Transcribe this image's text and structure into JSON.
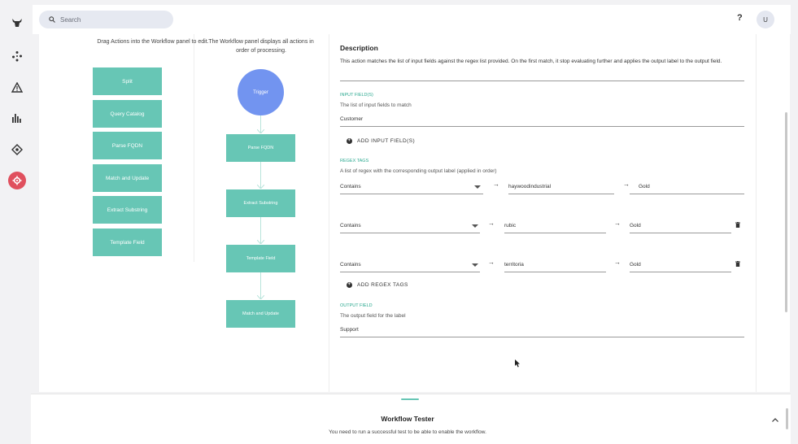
{
  "search": {
    "placeholder": "Search"
  },
  "header": {
    "help_label": "?",
    "avatar_initial": "U"
  },
  "nav": {
    "items": [
      {
        "icon": "bull-logo-icon"
      },
      {
        "icon": "workflow-nodes-icon"
      },
      {
        "icon": "warning-icon"
      },
      {
        "icon": "bar-chart-icon"
      },
      {
        "icon": "integration-icon"
      },
      {
        "icon": "settings-gear-icon",
        "active": true
      }
    ],
    "active_color": "#e0505e"
  },
  "actions_panel": {
    "title": "Drag Actions into the Workflow panel to edit.",
    "items": [
      "Split",
      "Query Catalog",
      "Parse FQDN",
      "Match and Update",
      "Extract Substring",
      "Template Field"
    ]
  },
  "workflow_panel": {
    "title": "The Workflow panel displays all actions in order of processing.",
    "trigger_label": "Trigger",
    "nodes": [
      "Parse FQDN",
      "Extract Substring",
      "Template Field",
      "Match and Update"
    ]
  },
  "details": {
    "description_heading": "Description",
    "description_text": "This action matches the list of input fields against the regex list provided. On the first match, it stop evaluating further and applies the output label to the output field.",
    "input_fields": {
      "label": "INPUT FIELD(S)",
      "helper": "The list of input fields to match",
      "value": "Customer",
      "add_label": "ADD INPUT FIELD(S)"
    },
    "regex_tags": {
      "label": "REGEX TAGS",
      "helper": "A list of regex with the corresponding output label (applied in order)",
      "rows": [
        {
          "operator": "Contains",
          "pattern": "haywoodindustrial",
          "output": "Gold",
          "deletable": false
        },
        {
          "operator": "Contains",
          "pattern": "rubic",
          "output": "Gold",
          "deletable": true
        },
        {
          "operator": "Contains",
          "pattern": "territoria",
          "output": "Gold",
          "deletable": true
        }
      ],
      "add_label": "ADD REGEX TAGS"
    },
    "output_field": {
      "label": "OUTPUT FIELD",
      "helper": "The output field for the label",
      "value": "Support"
    }
  },
  "tester": {
    "title": "Workflow Tester",
    "message": "You need to run a successful test to be able to enable the workflow."
  },
  "colors": {
    "accent": "#67c6b5",
    "trigger": "#7294f0",
    "label_green": "#2aa88f"
  }
}
